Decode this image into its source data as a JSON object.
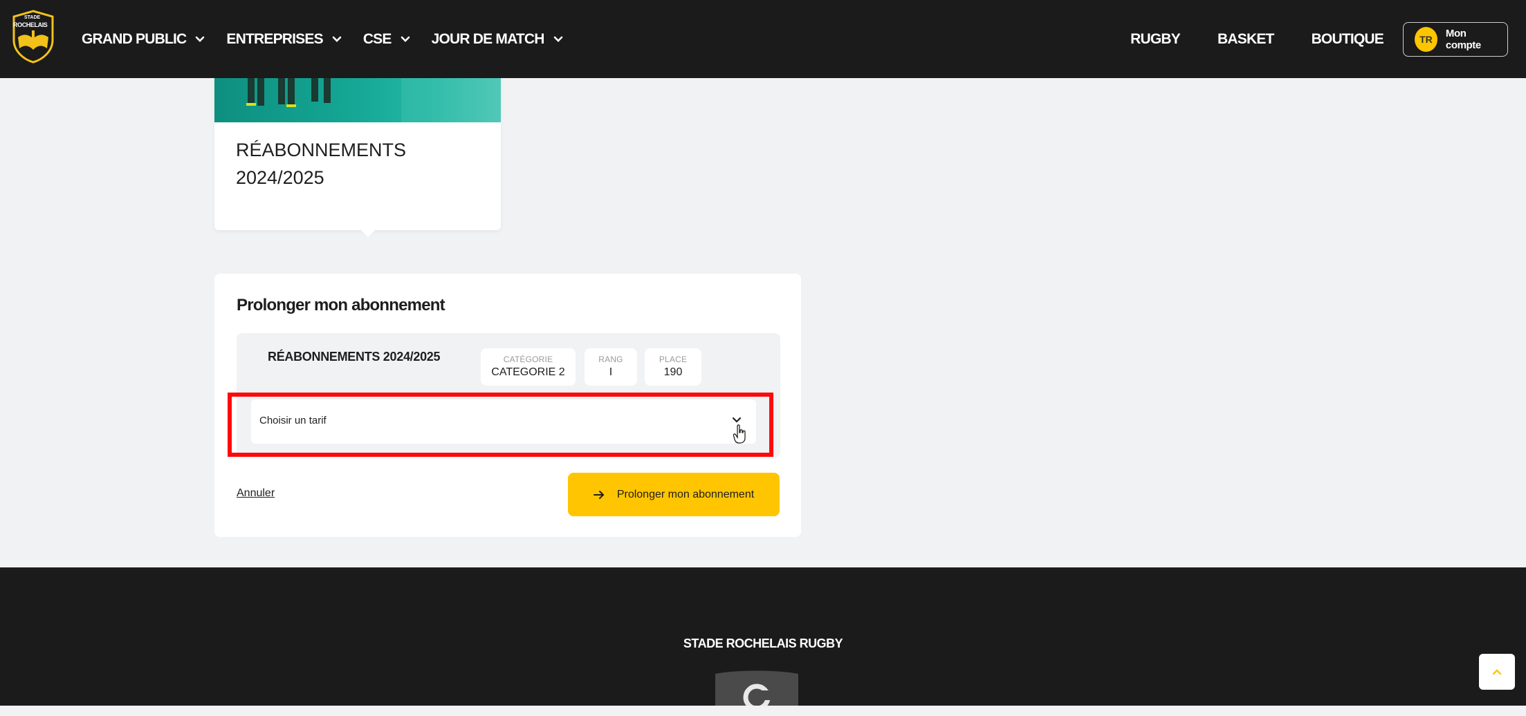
{
  "header": {
    "logo_text_top": "STADE",
    "logo_text_bottom": "ROCHELAIS",
    "nav_left": [
      {
        "label": "GRAND PUBLIC"
      },
      {
        "label": "ENTREPRISES"
      },
      {
        "label": "CSE"
      },
      {
        "label": "JOUR DE MATCH"
      }
    ],
    "nav_right": [
      {
        "label": "RUGBY"
      },
      {
        "label": "BASKET"
      },
      {
        "label": "BOUTIQUE"
      }
    ],
    "account": {
      "initials": "TR",
      "label": "Mon compte"
    }
  },
  "offer_card": {
    "title_line1": "RÉABONNEMENTS",
    "title_line2": "2024/2025"
  },
  "renewal_form": {
    "title": "Prolonger mon abonnement",
    "subscription_name": "RÉABONNEMENTS 2024/2025",
    "meta": [
      {
        "key": "CATÉGORIE",
        "value": "CATEGORIE 2"
      },
      {
        "key": "RANG",
        "value": "I"
      },
      {
        "key": "PLACE",
        "value": "190"
      }
    ],
    "tariff_select": {
      "placeholder": "Choisir un tarif"
    },
    "cancel_label": "Annuler",
    "submit_label": "Prolonger mon abonnement"
  },
  "footer": {
    "title": "STADE ROCHELAIS RUGBY"
  },
  "colors": {
    "header_bg": "#1b1b1b",
    "accent": "#ffc500",
    "highlight": "#ff0a0a",
    "page_bg": "#f1f2f4"
  }
}
